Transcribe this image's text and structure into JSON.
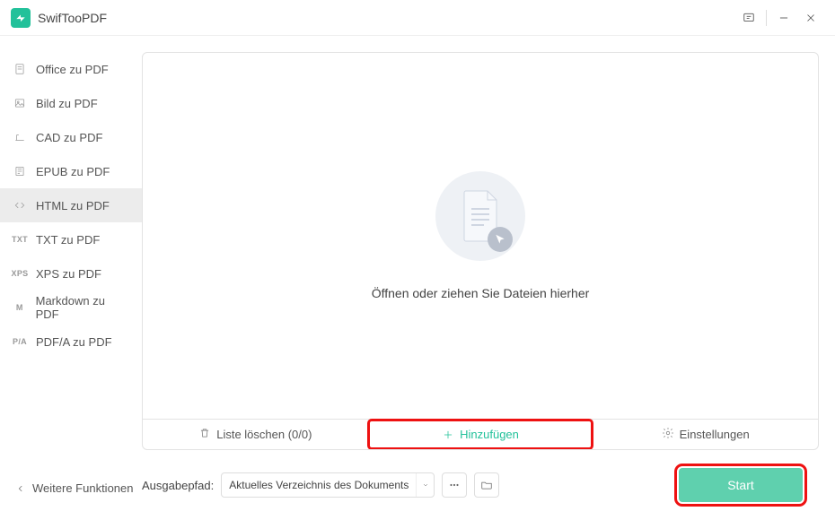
{
  "app": {
    "title": "SwifTooPDF"
  },
  "sidebar": {
    "items": [
      {
        "label": "Office zu PDF"
      },
      {
        "label": "Bild zu PDF"
      },
      {
        "label": "CAD zu PDF"
      },
      {
        "label": "EPUB zu PDF"
      },
      {
        "label": "HTML zu PDF"
      },
      {
        "label": "TXT zu PDF"
      },
      {
        "label": "XPS zu PDF"
      },
      {
        "label": "Markdown zu PDF"
      },
      {
        "label": "PDF/A zu PDF"
      }
    ]
  },
  "main": {
    "drop_text": "Öffnen oder ziehen Sie Dateien hierher",
    "clear_list": "Liste löschen (0/0)",
    "add": "Hinzufügen",
    "settings": "Einstellungen"
  },
  "footer": {
    "more": "Weitere Funktionen",
    "output_label": "Ausgabepfad:",
    "output_value": "Aktuelles Verzeichnis des Dokuments",
    "start": "Start"
  }
}
